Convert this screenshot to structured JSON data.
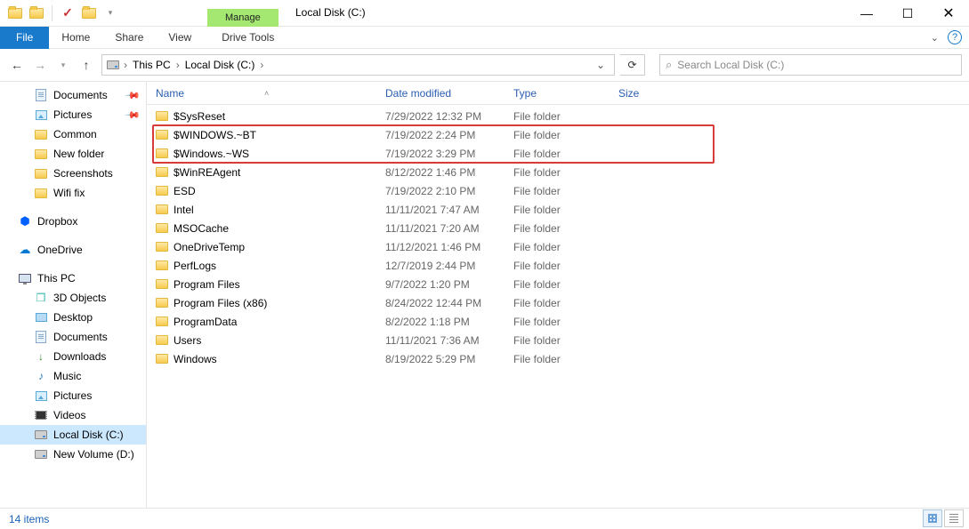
{
  "window": {
    "title": "Local Disk (C:)",
    "context_tab_group": "Manage",
    "context_tab": "Drive Tools"
  },
  "ribbon": {
    "file": "File",
    "tabs": [
      "Home",
      "Share",
      "View"
    ]
  },
  "breadcrumb": {
    "items": [
      "This PC",
      "Local Disk (C:)"
    ]
  },
  "search": {
    "placeholder": "Search Local Disk (C:)"
  },
  "sidebar": {
    "quick": [
      {
        "label": "Documents",
        "icon": "documents",
        "pinned": true
      },
      {
        "label": "Pictures",
        "icon": "pictures",
        "pinned": true
      },
      {
        "label": "Common",
        "icon": "folder",
        "pinned": false
      },
      {
        "label": "New folder",
        "icon": "folder",
        "pinned": false
      },
      {
        "label": "Screenshots",
        "icon": "folder",
        "pinned": false
      },
      {
        "label": "Wifi fix",
        "icon": "folder",
        "pinned": false
      }
    ],
    "cloud": [
      {
        "label": "Dropbox",
        "icon": "dropbox"
      },
      {
        "label": "OneDrive",
        "icon": "onedrive"
      }
    ],
    "thispc": {
      "label": "This PC"
    },
    "thispc_children": [
      {
        "label": "3D Objects",
        "icon": "cube"
      },
      {
        "label": "Desktop",
        "icon": "desktop"
      },
      {
        "label": "Documents",
        "icon": "documents"
      },
      {
        "label": "Downloads",
        "icon": "downloads"
      },
      {
        "label": "Music",
        "icon": "music"
      },
      {
        "label": "Pictures",
        "icon": "pictures"
      },
      {
        "label": "Videos",
        "icon": "videos"
      },
      {
        "label": "Local Disk (C:)",
        "icon": "drive",
        "selected": true
      },
      {
        "label": "New Volume (D:)",
        "icon": "drive"
      }
    ]
  },
  "columns": {
    "name": "Name",
    "date": "Date modified",
    "type": "Type",
    "size": "Size"
  },
  "files": [
    {
      "name": "$SysReset",
      "date": "7/29/2022 12:32 PM",
      "type": "File folder"
    },
    {
      "name": "$WINDOWS.~BT",
      "date": "7/19/2022 2:24 PM",
      "type": "File folder",
      "hl": true
    },
    {
      "name": "$Windows.~WS",
      "date": "7/19/2022 3:29 PM",
      "type": "File folder",
      "hl": true
    },
    {
      "name": "$WinREAgent",
      "date": "8/12/2022 1:46 PM",
      "type": "File folder"
    },
    {
      "name": "ESD",
      "date": "7/19/2022 2:10 PM",
      "type": "File folder"
    },
    {
      "name": "Intel",
      "date": "11/11/2021 7:47 AM",
      "type": "File folder"
    },
    {
      "name": "MSOCache",
      "date": "11/11/2021 7:20 AM",
      "type": "File folder"
    },
    {
      "name": "OneDriveTemp",
      "date": "11/12/2021 1:46 PM",
      "type": "File folder"
    },
    {
      "name": "PerfLogs",
      "date": "12/7/2019 2:44 PM",
      "type": "File folder"
    },
    {
      "name": "Program Files",
      "date": "9/7/2022 1:20 PM",
      "type": "File folder"
    },
    {
      "name": "Program Files (x86)",
      "date": "8/24/2022 12:44 PM",
      "type": "File folder"
    },
    {
      "name": "ProgramData",
      "date": "8/2/2022 1:18 PM",
      "type": "File folder"
    },
    {
      "name": "Users",
      "date": "11/11/2021 7:36 AM",
      "type": "File folder"
    },
    {
      "name": "Windows",
      "date": "8/19/2022 5:29 PM",
      "type": "File folder"
    }
  ],
  "status": {
    "count_label": "14 items"
  }
}
